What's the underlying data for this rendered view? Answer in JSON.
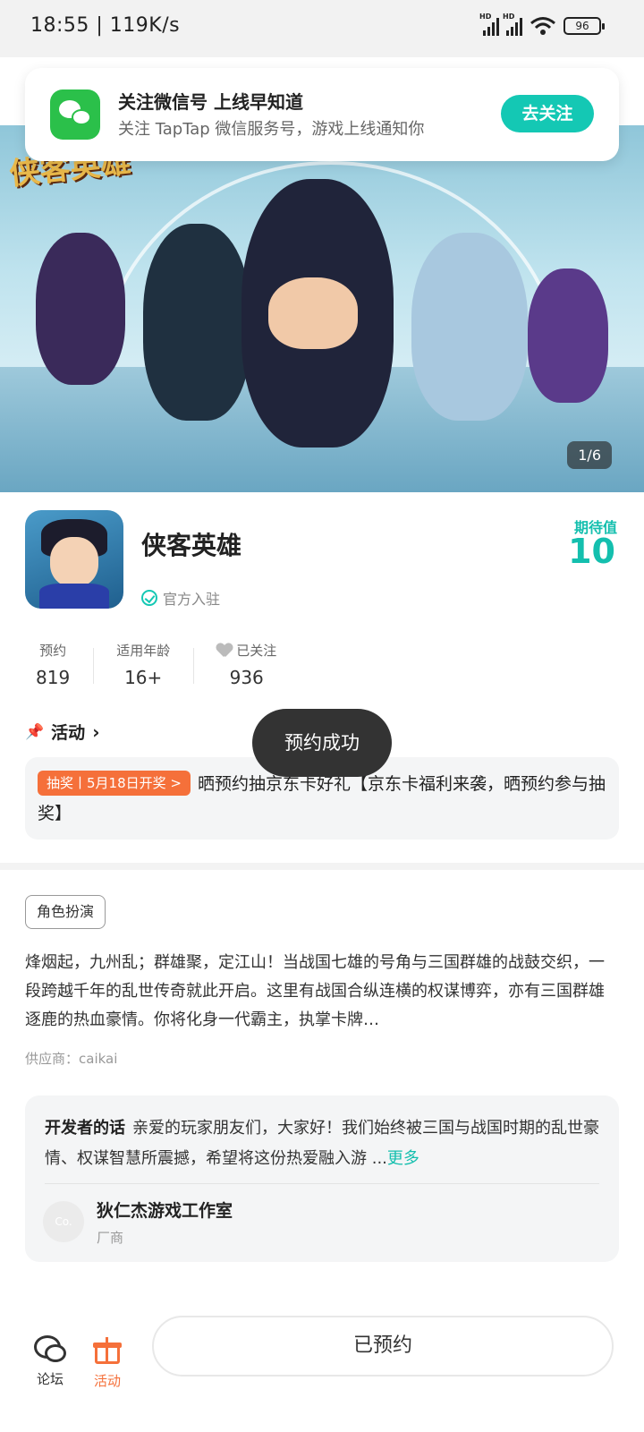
{
  "status_bar": {
    "time": "18:55 | 119K/s",
    "battery": "96"
  },
  "notice": {
    "title": "关注微信号 上线早知道",
    "subtitle": "关注 TapTap 微信服务号，游戏上线通知你",
    "button": "去关注"
  },
  "hero": {
    "counter": "1/6",
    "logo_text": "侠客英雄"
  },
  "game": {
    "title": "侠客英雄",
    "official": "官方入驻",
    "expect_label": "期待值",
    "expect_value": "10"
  },
  "stats": [
    {
      "label": "预约",
      "value": "819"
    },
    {
      "label": "适用年龄",
      "value": "16+"
    },
    {
      "label": "已关注",
      "value": "936"
    }
  ],
  "activity": {
    "heading": "活动",
    "tag": "抽奖丨5月18日开奖 >",
    "text": "晒预约抽京东卡好礼【京东卡福利来袭，晒预约参与抽奖】"
  },
  "toast": "预约成功",
  "genre": "角色扮演",
  "description": "烽烟起，九州乱；群雄聚，定江山！当战国七雄的号角与三国群雄的战鼓交织，一段跨越千年的乱世传奇就此开启。这里有战国合纵连横的权谋博弈，亦有三国群雄逐鹿的热血豪情。你将化身一代霸主，执掌卡牌…",
  "supplier": "供应商：caikai",
  "developer": {
    "label": "开发者的话",
    "text": "亲爱的玩家朋友们，大家好！我们始终被三国与战国时期的乱世豪情、权谋智慧所震撼，希望将这份热爱融入游 ...",
    "more": "更多",
    "avatar_text": "Co.",
    "name": "狄仁杰游戏工作室",
    "role": "厂商"
  },
  "bottom_bar": {
    "forum": "论坛",
    "activity": "活动",
    "reserved": "已预约"
  },
  "colors": {
    "accent": "#14c8b4",
    "orange": "#f5703a",
    "wechat": "#2bc04a"
  }
}
